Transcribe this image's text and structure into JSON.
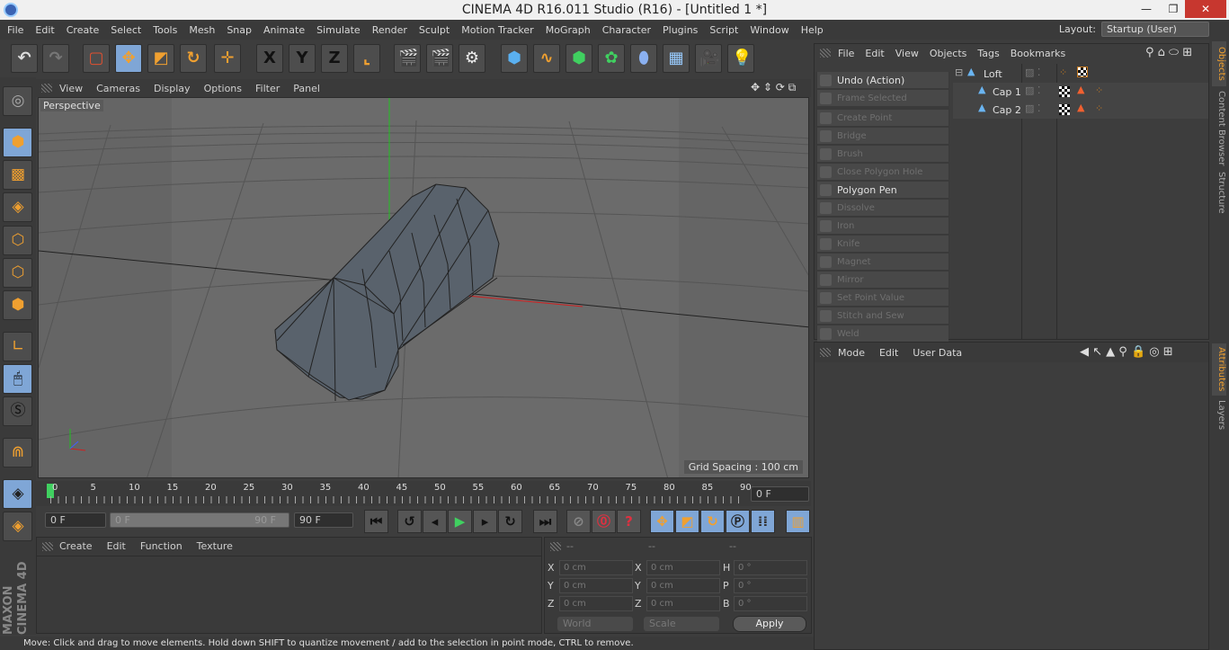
{
  "window": {
    "title": "CINEMA 4D R16.011 Studio (R16) - [Untitled 1 *]",
    "minimize": "—",
    "restore": "❐",
    "close": "✕"
  },
  "menu": [
    "File",
    "Edit",
    "Create",
    "Select",
    "Tools",
    "Mesh",
    "Snap",
    "Animate",
    "Simulate",
    "Render",
    "Sculpt",
    "Motion Tracker",
    "MoGraph",
    "Character",
    "Plugins",
    "Script",
    "Window",
    "Help"
  ],
  "layout": {
    "label": "Layout:",
    "value": "Startup (User)"
  },
  "toolbar": {
    "axis_x": "X",
    "axis_y": "Y",
    "axis_z": "Z",
    "active_tool": "move"
  },
  "viewport": {
    "menu": [
      "View",
      "Cameras",
      "Display",
      "Options",
      "Filter",
      "Panel"
    ],
    "label": "Perspective",
    "grid_spacing": "Grid Spacing : 100 cm"
  },
  "timeline": {
    "ticks": [
      "0",
      "5",
      "10",
      "15",
      "20",
      "25",
      "30",
      "35",
      "40",
      "45",
      "50",
      "55",
      "60",
      "65",
      "70",
      "75",
      "80",
      "85",
      "90"
    ],
    "current_frame": "0 F",
    "start": "0 F",
    "range_start": "0 F",
    "range_end": "90 F",
    "end": "90 F"
  },
  "material_manager": {
    "menu": [
      "Create",
      "Edit",
      "Function",
      "Texture"
    ]
  },
  "coordinates": {
    "headers": [
      "--",
      "--",
      "--"
    ],
    "rows": [
      {
        "l1": "X",
        "v1": "0 cm",
        "l2": "X",
        "v2": "0 cm",
        "l3": "H",
        "v3": "0 °"
      },
      {
        "l1": "Y",
        "v1": "0 cm",
        "l2": "Y",
        "v2": "0 cm",
        "l3": "P",
        "v3": "0 °"
      },
      {
        "l1": "Z",
        "v1": "0 cm",
        "l2": "Z",
        "v2": "0 cm",
        "l3": "B",
        "v3": "0 °"
      }
    ],
    "mode": "World",
    "transform": "Scale",
    "apply": "Apply"
  },
  "status": "Move: Click and drag to move elements. Hold down SHIFT to quantize movement / add to the selection in point mode, CTRL to remove.",
  "object_manager": {
    "menu": [
      "File",
      "Edit",
      "View",
      "Objects",
      "Tags",
      "Bookmarks"
    ],
    "objects": [
      {
        "name": "Loft"
      },
      {
        "name": "Cap 1"
      },
      {
        "name": "Cap 2"
      }
    ]
  },
  "commands": [
    {
      "label": "Undo (Action)",
      "enabled": true
    },
    {
      "label": "Frame Selected Elements",
      "enabled": false
    },
    {
      "label": "Create Point",
      "enabled": false
    },
    {
      "label": "Bridge",
      "enabled": false
    },
    {
      "label": "Brush",
      "enabled": false
    },
    {
      "label": "Close Polygon Hole",
      "enabled": false
    },
    {
      "label": "Polygon Pen",
      "enabled": true
    },
    {
      "label": "Dissolve",
      "enabled": false
    },
    {
      "label": "Iron",
      "enabled": false
    },
    {
      "label": "Knife",
      "enabled": false
    },
    {
      "label": "Magnet",
      "enabled": false
    },
    {
      "label": "Mirror",
      "enabled": false
    },
    {
      "label": "Set Point Value",
      "enabled": false
    },
    {
      "label": "Stitch and Sew",
      "enabled": false
    },
    {
      "label": "Weld",
      "enabled": false
    }
  ],
  "attributes": {
    "menu": [
      "Mode",
      "Edit",
      "User Data"
    ]
  },
  "right_tabs": [
    "Objects",
    "Content Browser",
    "Structure",
    "Attributes",
    "Layers"
  ],
  "brand": "MAXON CINEMA 4D",
  "colors": {
    "accent": "#f0a030",
    "selected": "#7fa6d6",
    "axis_x": "#d02020",
    "axis_y": "#20c020",
    "axis_z": "#4060ff"
  }
}
